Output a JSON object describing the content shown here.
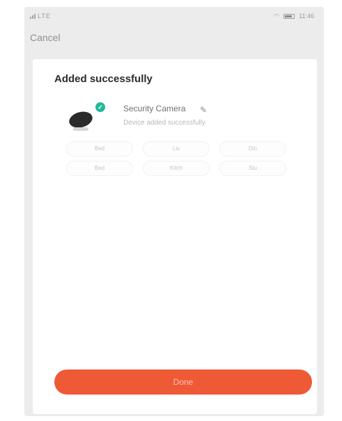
{
  "status_bar": {
    "left_text": "LTE",
    "right_text": "",
    "time": "11:46"
  },
  "header": {
    "cancel_label": "Cancel"
  },
  "card": {
    "title": "Added successfully",
    "device": {
      "name": "Security Camera",
      "status": "Device added successfully",
      "icon": "camera-icon",
      "badge_icon": "check-icon",
      "edit_icon": "edit-icon"
    },
    "rooms": [
      "Bed",
      "Liv",
      "Din",
      "Bed",
      "Kitch",
      "Stu"
    ]
  },
  "actions": {
    "done_label": "Done"
  },
  "colors": {
    "accent": "#ee5a36",
    "success_badge": "#24b99a",
    "background": "#ececec",
    "card": "#ffffff"
  }
}
